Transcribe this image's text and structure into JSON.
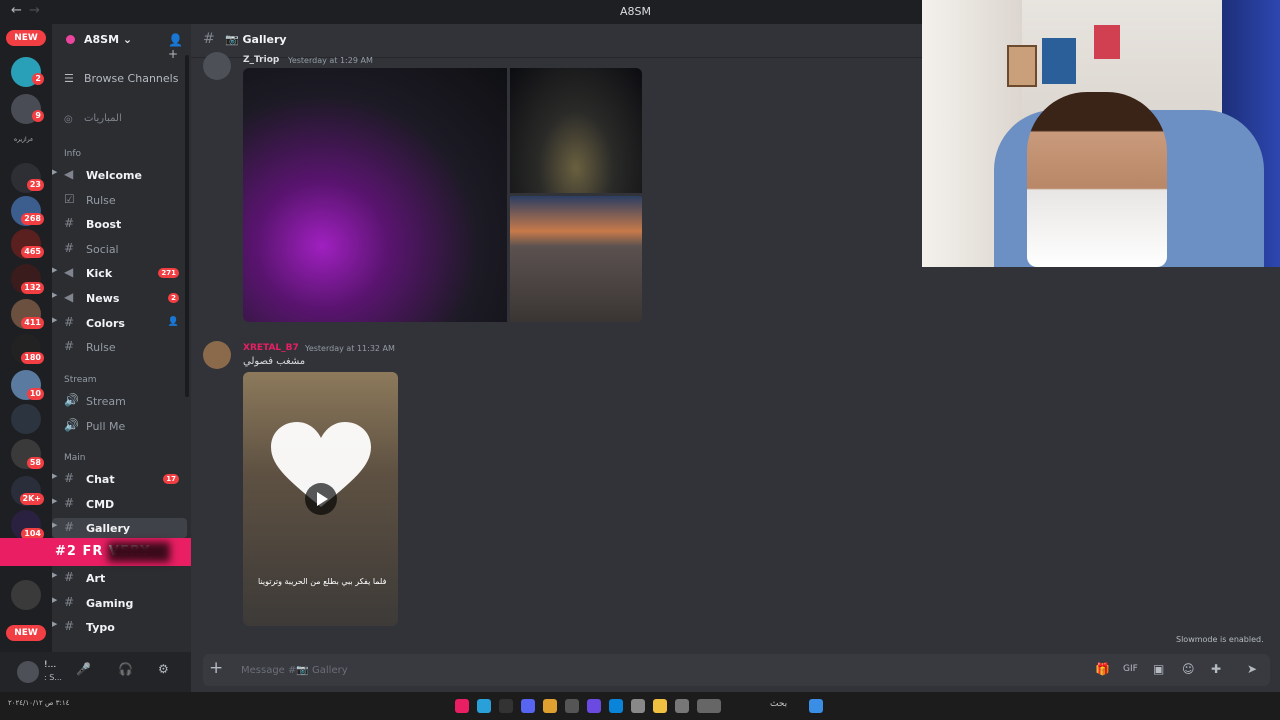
{
  "window": {
    "title": "A8SM",
    "back_icon": "←",
    "forward_icon": "→"
  },
  "guilds": {
    "new_top": "NEW",
    "new_bottom": "NEW",
    "label_arabic": "عرازيره",
    "badges": [
      "2",
      "9",
      "23",
      "268",
      "465",
      "132",
      "411",
      "180",
      "10",
      "58",
      "2K+",
      "104"
    ]
  },
  "server": {
    "name": "A8SM ⌄",
    "browse": "Browse Channels",
    "matches": "المباريات"
  },
  "categories": {
    "info": "Info",
    "stream": "Stream",
    "main": "Main"
  },
  "channels": {
    "welcome": "Welcome",
    "rulse": "Rulse",
    "boost": "Boost",
    "social": "Social",
    "kick": "Kick",
    "kick_count": "271",
    "news": "News",
    "news_count": "2",
    "colors": "Colors",
    "rulse2": "Rulse",
    "stream": "Stream",
    "pullme": "Pull Me",
    "chat": "Chat",
    "chat_count": "17",
    "cmd": "CMD",
    "gallery": "Gallery",
    "art": "Art",
    "gaming": "Gaming",
    "typo": "Typo"
  },
  "promo": {
    "text": "#2 FR          VERY"
  },
  "user": {
    "name": "!...",
    "status": ": S..."
  },
  "header": {
    "channel": "📷 Gallery"
  },
  "messages": [
    {
      "author": "Z_Triop",
      "time": "Yesterday at 1:29 AM",
      "color": "#dbdee1"
    },
    {
      "author": "XRETAL_B7",
      "time": "Yesterday at 11:32 AM",
      "text": "مشغب فصولي",
      "color": "#e91e63"
    }
  ],
  "video_caption": "فلما يفكر ببي بطلع من الحريبة وترتوينا",
  "slowmode": "Slowmode is enabled.",
  "composer": {
    "placeholder": "Message #📷 Gallery"
  },
  "taskbar": {
    "left_text": "٣:١٤ ص\n٢٠٢٤/١٠/١٢",
    "search": "بحث"
  },
  "colors": {
    "accent": "#5865f2",
    "danger": "#f23f43",
    "promo": "#e91e63"
  }
}
